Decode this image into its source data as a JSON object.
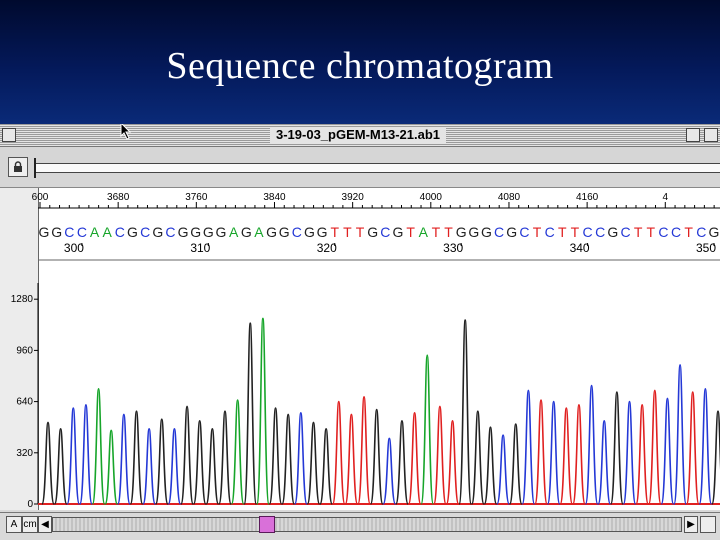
{
  "slide": {
    "title": "Sequence chromatogram"
  },
  "window": {
    "title": "3-19-03_pGEM-M13-21.ab1",
    "scroll_left_label": "A",
    "scroll_second_label": "cm",
    "scroll_left_arrow": "◀",
    "scroll_right_arrow": "▶"
  },
  "chart_data": {
    "type": "line",
    "title": "",
    "scan_ticks": [
      "600",
      "3680",
      "3760",
      "3840",
      "3920",
      "4000",
      "4080",
      "4160",
      "4"
    ],
    "sequence": "GGCCAACGCGCGGGGAGAGGCGGTTTGCGTATTGGGCGCTCTTCCGCTTCCTCG",
    "base_position_labels": [
      "300",
      "310",
      "320",
      "330",
      "340",
      "350"
    ],
    "base_label_indices": [
      3,
      13,
      23,
      33,
      43,
      53
    ],
    "y_ticks": [
      "1280",
      "960",
      "640",
      "320",
      "0"
    ],
    "y_tick_values": [
      1280,
      960,
      640,
      320,
      0
    ],
    "ylim": [
      0,
      1300
    ],
    "peaks": [
      510,
      470,
      600,
      620,
      720,
      460,
      560,
      580,
      470,
      530,
      470,
      610,
      520,
      470,
      580,
      650,
      1130,
      1160,
      600,
      560,
      570,
      510,
      470,
      640,
      560,
      670,
      590,
      410,
      520,
      570,
      930,
      610,
      520,
      1150,
      580,
      480,
      430,
      500,
      710,
      650,
      640,
      600,
      620,
      740,
      520,
      700,
      640,
      620,
      710,
      660,
      870,
      700,
      720,
      580
    ],
    "base_colors": {
      "G": "#222222",
      "C": "#2438d6",
      "A": "#17a52a",
      "T": "#e02020"
    }
  }
}
